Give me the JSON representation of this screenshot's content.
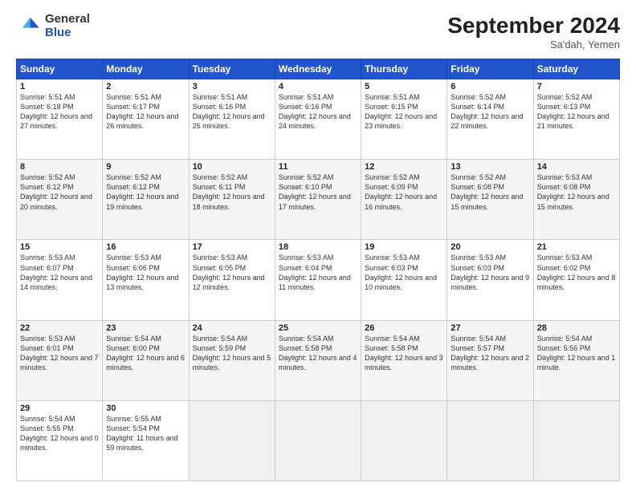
{
  "logo": {
    "general": "General",
    "blue": "Blue"
  },
  "title": "September 2024",
  "location": "Sa'dah, Yemen",
  "days_of_week": [
    "Sunday",
    "Monday",
    "Tuesday",
    "Wednesday",
    "Thursday",
    "Friday",
    "Saturday"
  ],
  "weeks": [
    [
      {
        "day": "1",
        "sunrise": "5:51 AM",
        "sunset": "6:18 PM",
        "daylight": "12 hours and 27 minutes."
      },
      {
        "day": "2",
        "sunrise": "5:51 AM",
        "sunset": "6:17 PM",
        "daylight": "12 hours and 26 minutes."
      },
      {
        "day": "3",
        "sunrise": "5:51 AM",
        "sunset": "6:16 PM",
        "daylight": "12 hours and 25 minutes."
      },
      {
        "day": "4",
        "sunrise": "5:51 AM",
        "sunset": "6:16 PM",
        "daylight": "12 hours and 24 minutes."
      },
      {
        "day": "5",
        "sunrise": "5:51 AM",
        "sunset": "6:15 PM",
        "daylight": "12 hours and 23 minutes."
      },
      {
        "day": "6",
        "sunrise": "5:52 AM",
        "sunset": "6:14 PM",
        "daylight": "12 hours and 22 minutes."
      },
      {
        "day": "7",
        "sunrise": "5:52 AM",
        "sunset": "6:13 PM",
        "daylight": "12 hours and 21 minutes."
      }
    ],
    [
      {
        "day": "8",
        "sunrise": "5:52 AM",
        "sunset": "6:12 PM",
        "daylight": "12 hours and 20 minutes."
      },
      {
        "day": "9",
        "sunrise": "5:52 AM",
        "sunset": "6:12 PM",
        "daylight": "12 hours and 19 minutes."
      },
      {
        "day": "10",
        "sunrise": "5:52 AM",
        "sunset": "6:11 PM",
        "daylight": "12 hours and 18 minutes."
      },
      {
        "day": "11",
        "sunrise": "5:52 AM",
        "sunset": "6:10 PM",
        "daylight": "12 hours and 17 minutes."
      },
      {
        "day": "12",
        "sunrise": "5:52 AM",
        "sunset": "6:09 PM",
        "daylight": "12 hours and 16 minutes."
      },
      {
        "day": "13",
        "sunrise": "5:52 AM",
        "sunset": "6:08 PM",
        "daylight": "12 hours and 15 minutes."
      },
      {
        "day": "14",
        "sunrise": "5:53 AM",
        "sunset": "6:08 PM",
        "daylight": "12 hours and 15 minutes."
      }
    ],
    [
      {
        "day": "15",
        "sunrise": "5:53 AM",
        "sunset": "6:07 PM",
        "daylight": "12 hours and 14 minutes."
      },
      {
        "day": "16",
        "sunrise": "5:53 AM",
        "sunset": "6:06 PM",
        "daylight": "12 hours and 13 minutes."
      },
      {
        "day": "17",
        "sunrise": "5:53 AM",
        "sunset": "6:05 PM",
        "daylight": "12 hours and 12 minutes."
      },
      {
        "day": "18",
        "sunrise": "5:53 AM",
        "sunset": "6:04 PM",
        "daylight": "12 hours and 11 minutes."
      },
      {
        "day": "19",
        "sunrise": "5:53 AM",
        "sunset": "6:03 PM",
        "daylight": "12 hours and 10 minutes."
      },
      {
        "day": "20",
        "sunrise": "5:53 AM",
        "sunset": "6:03 PM",
        "daylight": "12 hours and 9 minutes."
      },
      {
        "day": "21",
        "sunrise": "5:53 AM",
        "sunset": "6:02 PM",
        "daylight": "12 hours and 8 minutes."
      }
    ],
    [
      {
        "day": "22",
        "sunrise": "5:53 AM",
        "sunset": "6:01 PM",
        "daylight": "12 hours and 7 minutes."
      },
      {
        "day": "23",
        "sunrise": "5:54 AM",
        "sunset": "6:00 PM",
        "daylight": "12 hours and 6 minutes."
      },
      {
        "day": "24",
        "sunrise": "5:54 AM",
        "sunset": "5:59 PM",
        "daylight": "12 hours and 5 minutes."
      },
      {
        "day": "25",
        "sunrise": "5:54 AM",
        "sunset": "5:58 PM",
        "daylight": "12 hours and 4 minutes."
      },
      {
        "day": "26",
        "sunrise": "5:54 AM",
        "sunset": "5:58 PM",
        "daylight": "12 hours and 3 minutes."
      },
      {
        "day": "27",
        "sunrise": "5:54 AM",
        "sunset": "5:57 PM",
        "daylight": "12 hours and 2 minutes."
      },
      {
        "day": "28",
        "sunrise": "5:54 AM",
        "sunset": "5:56 PM",
        "daylight": "12 hours and 1 minute."
      }
    ],
    [
      {
        "day": "29",
        "sunrise": "5:54 AM",
        "sunset": "5:55 PM",
        "daylight": "12 hours and 0 minutes."
      },
      {
        "day": "30",
        "sunrise": "5:55 AM",
        "sunset": "5:54 PM",
        "daylight": "11 hours and 59 minutes."
      },
      null,
      null,
      null,
      null,
      null
    ]
  ]
}
